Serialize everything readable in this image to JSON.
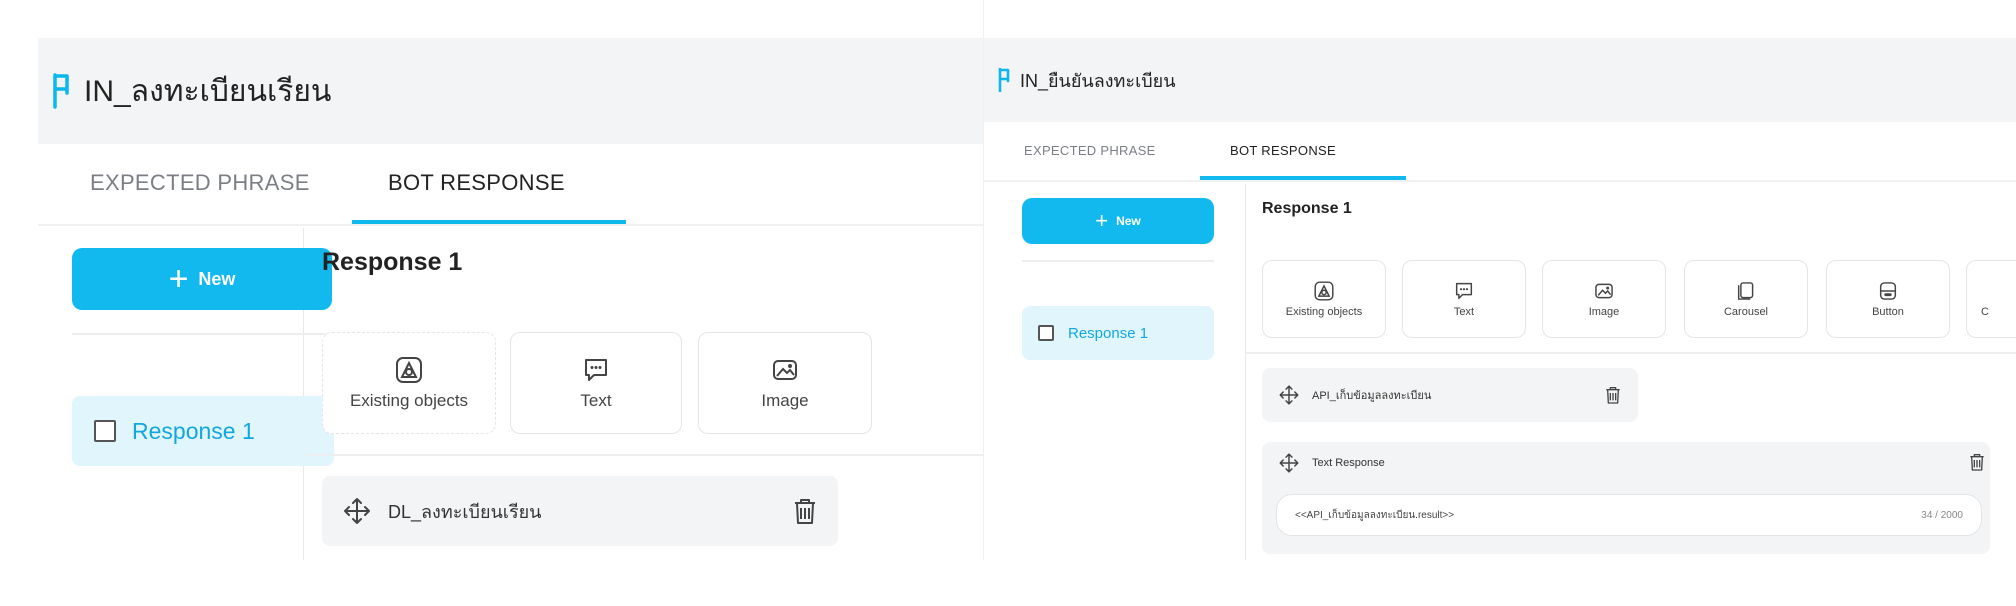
{
  "left_panel": {
    "intent": {
      "flag_glyph": "ᶟ",
      "name": "IN_ลงทะเบียนเรียน"
    },
    "tabs": [
      {
        "label": "EXPECTED PHRASE"
      },
      {
        "label": "BOT RESPONSE"
      }
    ],
    "new_button": {
      "label": "New"
    },
    "responses": [
      {
        "label": "Response 1"
      }
    ],
    "response_title": "Response 1",
    "types": [
      {
        "label": "Existing objects",
        "icon": "existing-objects-icon"
      },
      {
        "label": "Text",
        "icon": "text-icon"
      },
      {
        "label": "Image",
        "icon": "image-icon"
      }
    ],
    "objects": [
      {
        "label": "DL_ลงทะเบียนเรียน"
      }
    ]
  },
  "right_panel": {
    "intent": {
      "name": "IN_ยืนยันลงทะเบียน"
    },
    "tabs": [
      {
        "label": "EXPECTED PHRASE"
      },
      {
        "label": "BOT RESPONSE"
      }
    ],
    "new_button": {
      "label": "New"
    },
    "responses": [
      {
        "label": "Response 1"
      }
    ],
    "response_title": "Response 1",
    "types": [
      {
        "label": "Existing objects",
        "icon": "existing-objects-icon"
      },
      {
        "label": "Text",
        "icon": "text-icon"
      },
      {
        "label": "Image",
        "icon": "image-icon"
      },
      {
        "label": "Carousel",
        "icon": "carousel-icon"
      },
      {
        "label": "Button",
        "icon": "button-icon"
      },
      {
        "label": "C",
        "icon": "cut-off"
      }
    ],
    "objects": [
      {
        "label": "API_เก็บข้อมูลลงทะเบียน"
      }
    ],
    "text_response": {
      "label": "Text Response",
      "value": "<<API_เก็บข้อมูลลงทะเบียน.result>>",
      "counter": "34 / 2000"
    }
  },
  "colors": {
    "accent": "#12b9ef",
    "header_bg": "#f3f4f5",
    "selected_bg": "#e1f5fd"
  }
}
